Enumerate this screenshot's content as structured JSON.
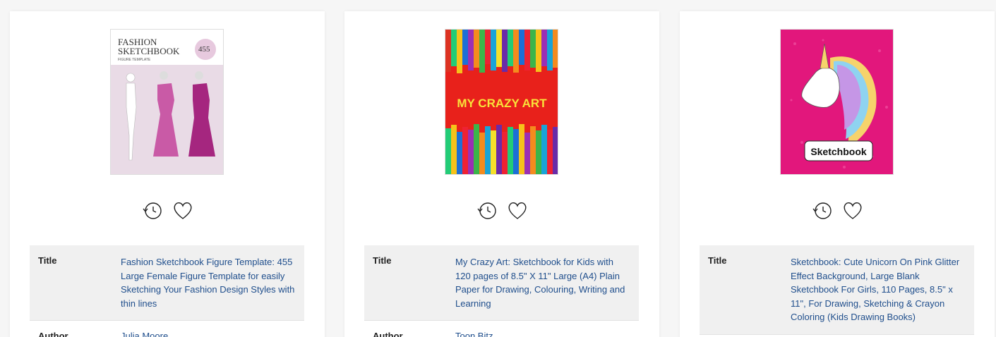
{
  "books": [
    {
      "cover_alt": "Fashion Sketchbook cover",
      "cover_text": {
        "l1": "FASHION",
        "l2": "SKETCHBOOK",
        "l3": "FIGURE TEMPLATE",
        "badge": "455"
      },
      "title_label": "Title",
      "title": "Fashion Sketchbook Figure Template: 455 Large Female Figure Template for easily Sketching Your Fashion Design Styles with thin lines",
      "author_label": "Author",
      "author": "Julia Moore,"
    },
    {
      "cover_alt": "My Crazy Art cover",
      "cover_text": {
        "main": "MY CRAZY ART"
      },
      "title_label": "Title",
      "title": "My Crazy Art: Sketchbook for Kids with 120 pages of 8.5\" X 11\" Large (A4) Plain Paper for Drawing, Colouring, Writing and Learning",
      "author_label": "Author",
      "author": "Toon Bitz,"
    },
    {
      "cover_alt": "Sketchbook unicorn cover",
      "cover_text": {
        "main": "Sketchbook"
      },
      "title_label": "Title",
      "title": "Sketchbook: Cute Unicorn On Pink Glitter Effect Background, Large Blank Sketchbook For Girls, 110 Pages, 8.5\" x 11\", For Drawing, Sketching & Crayon Coloring (Kids Drawing Books)"
    }
  ],
  "icons": {
    "history": "clock-history-icon",
    "favorite": "heart-icon"
  }
}
